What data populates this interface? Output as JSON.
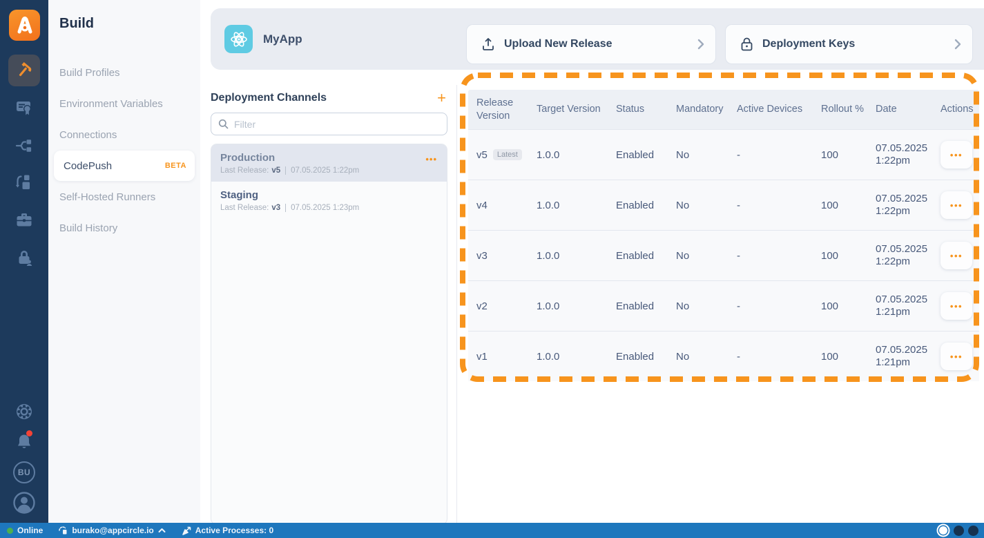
{
  "colors": {
    "accent_orange": "#f7941d",
    "rail_bg": "#1d3a5c",
    "header_bg": "#e9ecf2",
    "selected_channel_bg": "#e2e6ef",
    "statusbar_bg": "#1e77bd",
    "online_green": "#4caf50",
    "notification_red": "#f44336",
    "app_icon_bg": "#5fcbe3"
  },
  "nav_rail": {
    "logo_icon": "appcircle-logo",
    "top_icons": [
      "hammer-icon",
      "certificate-icon",
      "branch-split-icon",
      "publish-flow-icon",
      "briefcase-icon",
      "lock-user-icon"
    ],
    "active_icon": "hammer-icon",
    "bottom_icons": [
      "gear-icon",
      "bell-icon"
    ],
    "bell_has_notification": true,
    "org_initials": "BU",
    "profile_icon": "person-icon"
  },
  "sidebar": {
    "title": "Build",
    "items": [
      {
        "label": "Build Profiles",
        "active": false
      },
      {
        "label": "Environment Variables",
        "active": false
      },
      {
        "label": "Connections",
        "active": false
      },
      {
        "label": "CodePush",
        "badge": "BETA",
        "active": true
      },
      {
        "label": "Self-Hosted Runners",
        "active": false
      },
      {
        "label": "Build History",
        "active": false
      }
    ]
  },
  "header": {
    "app_name": "MyApp",
    "app_icon": "react-icon",
    "upload_button": {
      "label": "Upload New Release",
      "icon": "upload-icon",
      "chevron": "chevron-right-icon"
    },
    "keys_button": {
      "label": "Deployment Keys",
      "icon": "lock-icon",
      "chevron": "chevron-right-icon"
    }
  },
  "channels": {
    "title": "Deployment Channels",
    "add_icon": "plus-icon",
    "filter_placeholder": "Filter",
    "filter_icon": "search-icon",
    "items": [
      {
        "name": "Production",
        "last_release_label": "Last Release:",
        "version": "v5",
        "date": "07.05.2025 1:22pm",
        "selected": true,
        "menu_icon": "ellipsis-icon"
      },
      {
        "name": "Staging",
        "last_release_label": "Last Release:",
        "version": "v3",
        "date": "07.05.2025 1:23pm",
        "selected": false
      }
    ]
  },
  "releases_table": {
    "columns": [
      "Release Version",
      "Target Version",
      "Status",
      "Mandatory",
      "Active Devices",
      "Rollout %",
      "Date",
      "Actions"
    ],
    "rows": [
      {
        "release": "v5",
        "badge": "Latest",
        "target": "1.0.0",
        "status": "Enabled",
        "mandatory": "No",
        "active_devices": "-",
        "rollout": "100",
        "date": "07.05.2025 1:22pm"
      },
      {
        "release": "v4",
        "target": "1.0.0",
        "status": "Enabled",
        "mandatory": "No",
        "active_devices": "-",
        "rollout": "100",
        "date": "07.05.2025 1:22pm"
      },
      {
        "release": "v3",
        "target": "1.0.0",
        "status": "Enabled",
        "mandatory": "No",
        "active_devices": "-",
        "rollout": "100",
        "date": "07.05.2025 1:22pm"
      },
      {
        "release": "v2",
        "target": "1.0.0",
        "status": "Enabled",
        "mandatory": "No",
        "active_devices": "-",
        "rollout": "100",
        "date": "07.05.2025 1:21pm"
      },
      {
        "release": "v1",
        "target": "1.0.0",
        "status": "Enabled",
        "mandatory": "No",
        "active_devices": "-",
        "rollout": "100",
        "date": "07.05.2025 1:21pm"
      }
    ],
    "row_menu_icon": "ellipsis-icon"
  },
  "annotation": {
    "shape": "dashed-rounded-rect",
    "color": "#f7941d"
  },
  "status_bar": {
    "online_label": "Online",
    "user_email": "burako@appcircle.io",
    "processes_label": "Active Processes: 0",
    "icons": [
      "sync-icon",
      "chevron-up-icon",
      "arrow-ne-icon"
    ],
    "theme_dots": [
      "light-selected",
      "dark",
      "dark"
    ]
  }
}
